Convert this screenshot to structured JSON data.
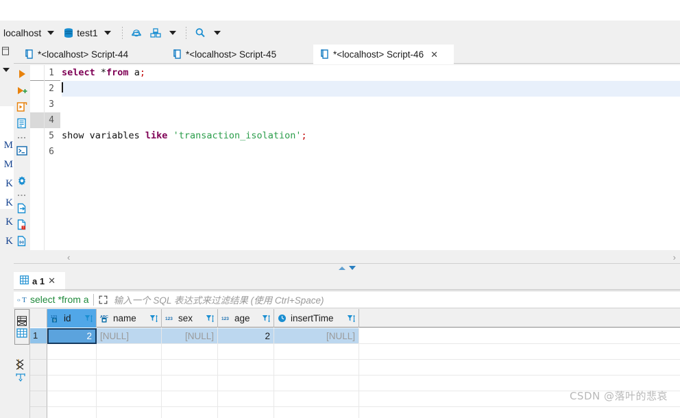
{
  "toolbar": {
    "connection": "localhost",
    "database": "test1",
    "icons": [
      {
        "name": "database-icon"
      },
      {
        "name": "gauge-icon"
      },
      {
        "name": "blocks-icon"
      },
      {
        "name": "search-icon"
      }
    ]
  },
  "editor_tabs": [
    {
      "label": "*<localhost> Script-44",
      "active": false,
      "closable": false
    },
    {
      "label": "*<localhost> Script-45",
      "active": false,
      "closable": false
    },
    {
      "label": "*<localhost> Script-46",
      "active": true,
      "closable": true,
      "close": "✕"
    }
  ],
  "left_edge_labels": [
    "Μ",
    "Μ",
    "K",
    "K",
    "K",
    "K"
  ],
  "editor": {
    "lines": [
      {
        "no": "1",
        "current": false,
        "tokens": [
          {
            "t": "select ",
            "c": "kw"
          },
          {
            "t": "*",
            "c": "pln"
          },
          {
            "t": "from",
            "c": "kw"
          },
          {
            "t": " a",
            "c": "pln"
          },
          {
            "t": ";",
            "c": "pun"
          }
        ]
      },
      {
        "no": "2",
        "current": false,
        "caret": true,
        "highlight": true,
        "tokens": []
      },
      {
        "no": "3",
        "current": false,
        "tokens": []
      },
      {
        "no": "4",
        "current": true,
        "tokens": []
      },
      {
        "no": "5",
        "current": false,
        "tokens": [
          {
            "t": "show variables ",
            "c": "pln"
          },
          {
            "t": "like",
            "c": "kw"
          },
          {
            "t": " ",
            "c": "pln"
          },
          {
            "t": "'transaction_isolation'",
            "c": "str"
          },
          {
            "t": ";",
            "c": "pun"
          }
        ]
      },
      {
        "no": "6",
        "current": false,
        "tokens": []
      }
    ],
    "scroll_left": "‹",
    "scroll_right": "›"
  },
  "results": {
    "tab_label": "a 1",
    "tab_close": "✕",
    "filter": {
      "query": "select *from a",
      "placeholder": "输入一个 SQL 表达式来过滤结果 (使用 Ctrl+Space)"
    },
    "columns": [
      {
        "name": "id",
        "type": "number",
        "type_label": "123",
        "selected": true,
        "width": 72
      },
      {
        "name": "name",
        "type": "text",
        "type_label": "ABC",
        "selected": false,
        "width": 95
      },
      {
        "name": "sex",
        "type": "number",
        "type_label": "123",
        "selected": false,
        "width": 82
      },
      {
        "name": "age",
        "type": "number",
        "type_label": "123",
        "selected": false,
        "width": 82
      },
      {
        "name": "insertTime",
        "type": "datetime",
        "type_label": "clock",
        "selected": false,
        "width": 124
      }
    ],
    "rows": [
      {
        "num": "1",
        "selected": true,
        "cells": [
          {
            "v": "2",
            "null": false,
            "align": "right",
            "focus": true
          },
          {
            "v": "[NULL]",
            "null": true,
            "align": "left"
          },
          {
            "v": "[NULL]",
            "null": true,
            "align": "right"
          },
          {
            "v": "2",
            "null": false,
            "align": "right"
          },
          {
            "v": "[NULL]",
            "null": true,
            "align": "right"
          }
        ]
      },
      {
        "num": "",
        "selected": false,
        "cells": [
          {
            "v": "",
            "null": false
          },
          {
            "v": "",
            "null": false
          },
          {
            "v": "",
            "null": false
          },
          {
            "v": "",
            "null": false
          },
          {
            "v": "",
            "null": false
          }
        ]
      },
      {
        "num": "",
        "selected": false,
        "cells": [
          {
            "v": "",
            "null": false
          },
          {
            "v": "",
            "null": false
          },
          {
            "v": "",
            "null": false
          },
          {
            "v": "",
            "null": false
          },
          {
            "v": "",
            "null": false
          }
        ]
      },
      {
        "num": "",
        "selected": false,
        "cells": [
          {
            "v": "",
            "null": false
          },
          {
            "v": "",
            "null": false
          },
          {
            "v": "",
            "null": false
          },
          {
            "v": "",
            "null": false
          },
          {
            "v": "",
            "null": false
          }
        ]
      },
      {
        "num": "",
        "selected": false,
        "cells": [
          {
            "v": "",
            "null": false
          },
          {
            "v": "",
            "null": false
          },
          {
            "v": "",
            "null": false
          },
          {
            "v": "",
            "null": false
          },
          {
            "v": "",
            "null": false
          }
        ]
      },
      {
        "num": "",
        "selected": false,
        "cells": [
          {
            "v": "",
            "null": false
          },
          {
            "v": "",
            "null": false
          },
          {
            "v": "",
            "null": false
          },
          {
            "v": "",
            "null": false
          },
          {
            "v": "",
            "null": false
          }
        ]
      }
    ]
  },
  "watermark": "CSDN @落叶的悲哀"
}
